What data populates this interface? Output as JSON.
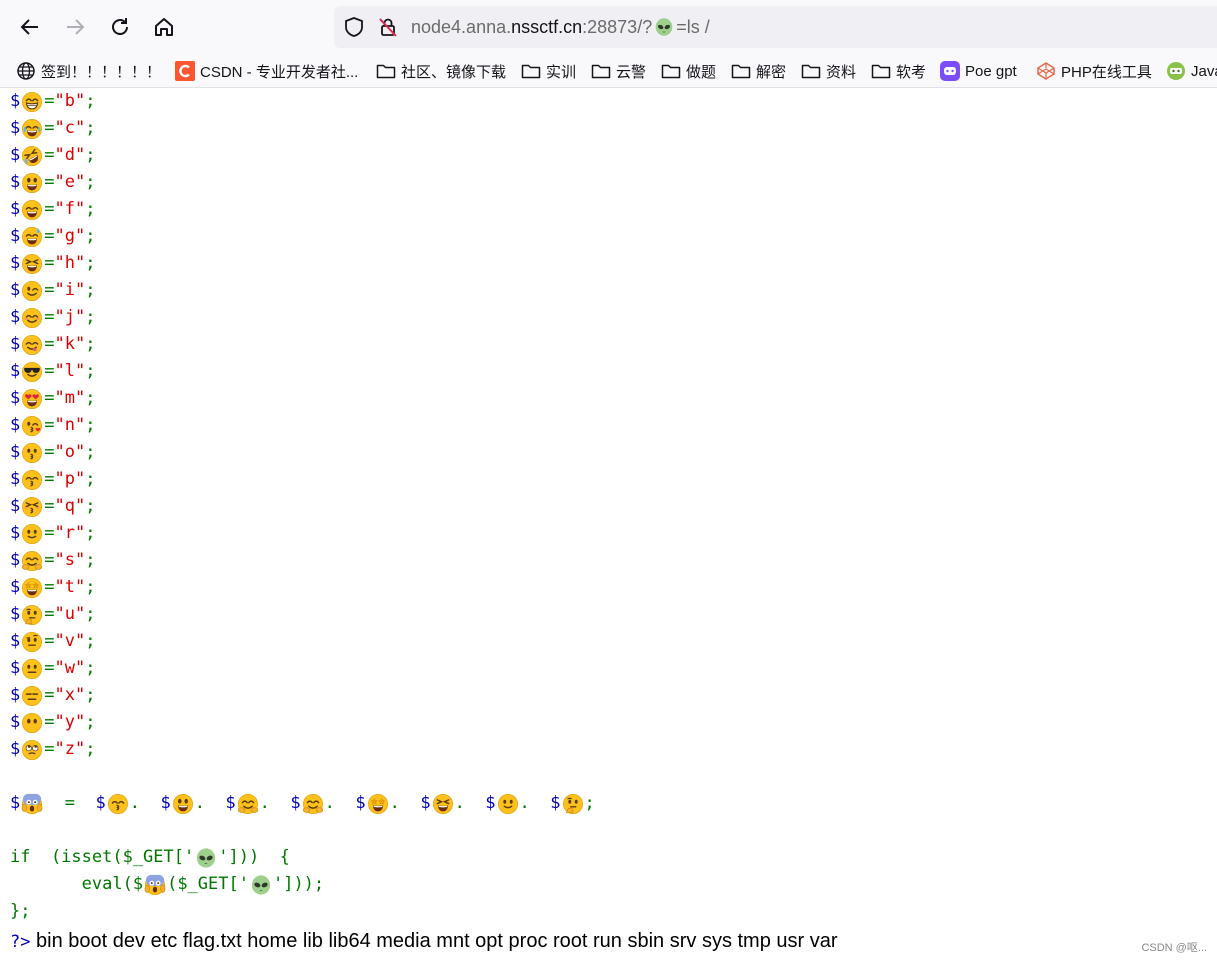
{
  "browser": {
    "url": {
      "host_prefix": "node4.anna.",
      "domain": "nssctf.cn",
      "suffix": ":28873/?",
      "param_icon": "alien-emoji",
      "query": "=ls /"
    }
  },
  "bookmarks": [
    {
      "label": "签到！！！！！！",
      "icon": "globe-icon"
    },
    {
      "label": "CSDN - 专业开发者社...",
      "icon": "csdn-logo-icon"
    },
    {
      "label": "社区、镜像下载",
      "icon": "folder-icon"
    },
    {
      "label": "实训",
      "icon": "folder-icon"
    },
    {
      "label": "云警",
      "icon": "folder-icon"
    },
    {
      "label": "做题",
      "icon": "folder-icon"
    },
    {
      "label": "解密",
      "icon": "folder-icon"
    },
    {
      "label": "资料",
      "icon": "folder-icon"
    },
    {
      "label": "软考",
      "icon": "folder-icon"
    },
    {
      "label": "Poe gpt",
      "icon": "poe-icon"
    },
    {
      "label": "PHP在线工具",
      "icon": "codepen-icon"
    },
    {
      "label": "Java",
      "icon": "java-icon"
    }
  ],
  "code": {
    "assignments": [
      {
        "letter": "b",
        "emoji": "grin"
      },
      {
        "letter": "c",
        "emoji": "joy"
      },
      {
        "letter": "d",
        "emoji": "rofl"
      },
      {
        "letter": "e",
        "emoji": "smiley"
      },
      {
        "letter": "f",
        "emoji": "smile"
      },
      {
        "letter": "g",
        "emoji": "sweat-smile"
      },
      {
        "letter": "h",
        "emoji": "laughing"
      },
      {
        "letter": "i",
        "emoji": "wink"
      },
      {
        "letter": "j",
        "emoji": "blush"
      },
      {
        "letter": "k",
        "emoji": "yum"
      },
      {
        "letter": "l",
        "emoji": "sunglasses"
      },
      {
        "letter": "m",
        "emoji": "heart-eyes"
      },
      {
        "letter": "n",
        "emoji": "kissing-heart"
      },
      {
        "letter": "o",
        "emoji": "kissing"
      },
      {
        "letter": "p",
        "emoji": "kissing-smiling"
      },
      {
        "letter": "q",
        "emoji": "kissing-closed"
      },
      {
        "letter": "r",
        "emoji": "slight-smile"
      },
      {
        "letter": "s",
        "emoji": "hugging"
      },
      {
        "letter": "t",
        "emoji": "star-struck"
      },
      {
        "letter": "u",
        "emoji": "thinking"
      },
      {
        "letter": "v",
        "emoji": "raised-eyebrow"
      },
      {
        "letter": "w",
        "emoji": "neutral"
      },
      {
        "letter": "x",
        "emoji": "expressionless"
      },
      {
        "letter": "y",
        "emoji": "no-mouth"
      },
      {
        "letter": "z",
        "emoji": "eye-roll"
      }
    ],
    "concat": {
      "target": "scream",
      "parts": [
        "kissing-smiling",
        "smiley",
        "hugging",
        "hugging",
        "star-struck",
        "laughing",
        "slight-smile",
        "thinking"
      ]
    },
    "if_open": "if  (isset($_GET['",
    "if_close": "']))  {",
    "eval_open": "eval($",
    "eval_mid": "($_GET['",
    "eval_close": "']));",
    "block_end": "};",
    "eq": " = ",
    "dot": ".",
    "semicolon": ";",
    "dollar": "$"
  },
  "output": {
    "tag": "?>",
    "text": "bin boot dev etc flag.txt home lib lib64 media mnt opt proc root run sbin srv sys tmp usr var"
  },
  "watermark": "CSDN @呕..."
}
